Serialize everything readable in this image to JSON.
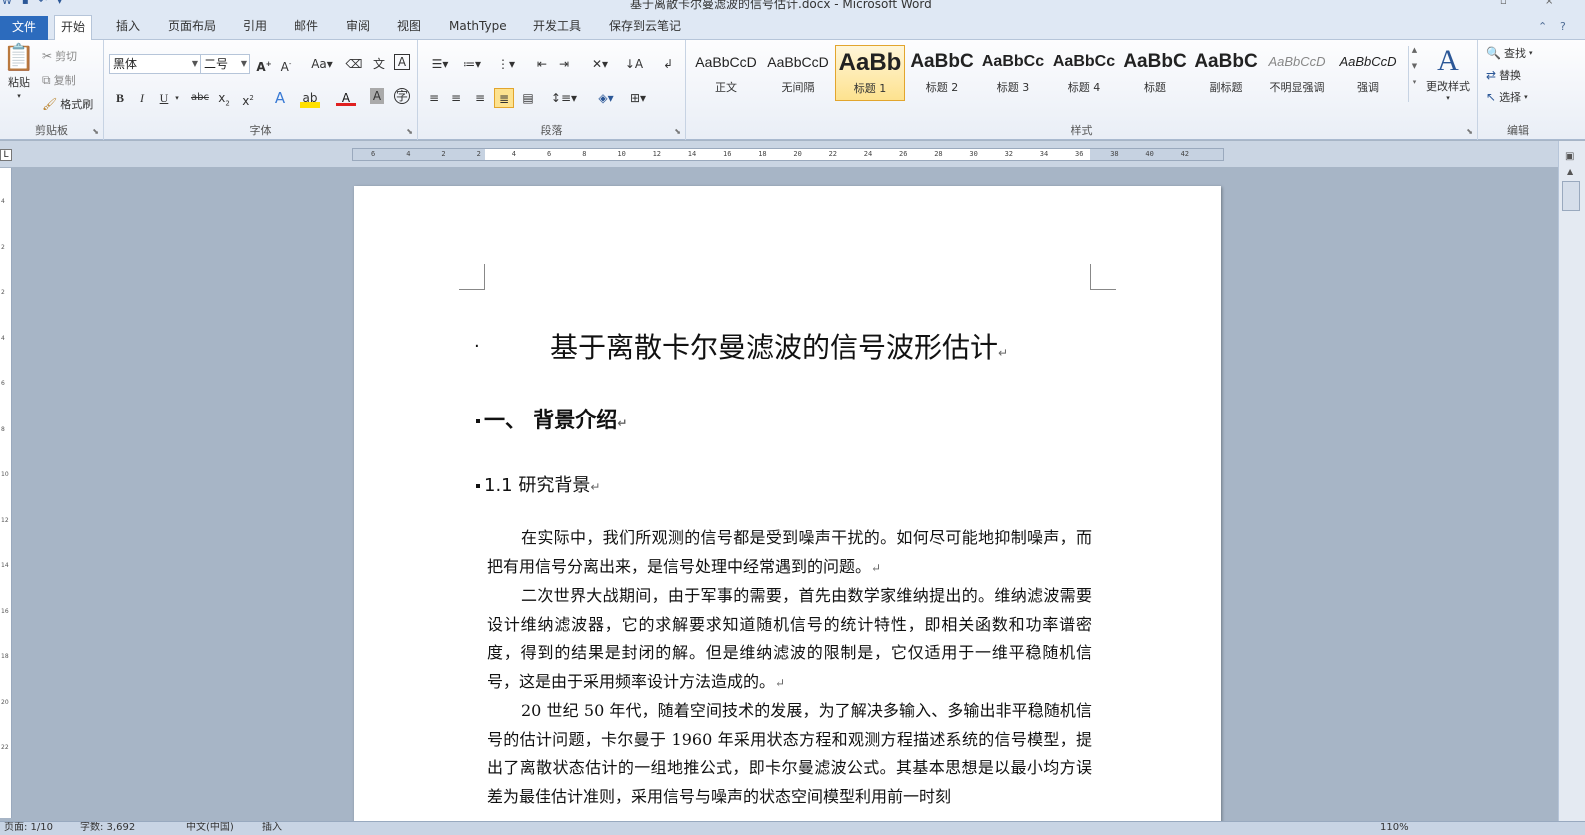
{
  "window": {
    "title": "基于离散卡尔曼滤波的信号估计.docx - Microsoft Word"
  },
  "tabs": [
    "文件",
    "开始",
    "插入",
    "页面布局",
    "引用",
    "邮件",
    "审阅",
    "视图",
    "MathType",
    "开发工具",
    "保存到云笔记"
  ],
  "active_tab": "开始",
  "clipboard": {
    "paste": "粘贴",
    "cut": "剪切",
    "copy": "复制",
    "format_painter": "格式刷",
    "label": "剪贴板"
  },
  "font": {
    "family": "黑体",
    "size": "二号",
    "label": "字体"
  },
  "paragraph": {
    "label": "段落"
  },
  "styles": {
    "label": "样式",
    "items": [
      {
        "preview": "AaBbCcD",
        "name": "正文"
      },
      {
        "preview": "AaBbCcD",
        "name": "无间隔"
      },
      {
        "preview": "AaBb",
        "name": "标题 1"
      },
      {
        "preview": "AaBbC",
        "name": "标题 2"
      },
      {
        "preview": "AaBbCc",
        "name": "标题 3"
      },
      {
        "preview": "AaBbCc",
        "name": "标题 4"
      },
      {
        "preview": "AaBbC",
        "name": "标题"
      },
      {
        "preview": "AaBbC",
        "name": "副标题"
      },
      {
        "preview": "AaBbCcD",
        "name": "不明显强调"
      },
      {
        "preview": "AaBbCcD",
        "name": "强调"
      }
    ],
    "change": "更改样式"
  },
  "editing": {
    "find": "查找",
    "replace": "替换",
    "select": "选择",
    "label": "编辑"
  },
  "ruler": {
    "ticks": [
      "6",
      "4",
      "2",
      "2",
      "4",
      "6",
      "8",
      "10",
      "12",
      "14",
      "16",
      "18",
      "20",
      "22",
      "24",
      "26",
      "28",
      "30",
      "32",
      "34",
      "36",
      "38",
      "40",
      "42"
    ],
    "vticks": [
      "4",
      "2",
      "2",
      "4",
      "6",
      "8",
      "10",
      "12",
      "14",
      "16",
      "18",
      "20",
      "22"
    ]
  },
  "document": {
    "title": "基于离散卡尔曼滤波的信号波形估计",
    "heading1": "一、  背景介绍",
    "heading2": "1.1  研究背景",
    "paragraphs": [
      "在实际中，我们所观测的信号都是受到噪声干扰的。如何尽可能地抑制噪声，而把有用信号分离出来，是信号处理中经常遇到的问题。",
      "二次世界大战期间，由于军事的需要，首先由数学家维纳提出的。维纳滤波需要设计维纳滤波器，它的求解要求知道随机信号的统计特性，即相关函数和功率谱密度，得到的结果是封闭的解。但是维纳滤波的限制是，它仅适用于一维平稳随机信号，这是由于采用频率设计方法造成的。",
      "20 世纪 50 年代，随着空间技术的发展，为了解决多输入、多输出非平稳随机信号的估计问题，卡尔曼于 1960 年采用状态方程和观测方程描述系统的信号模型，提出了离散状态估计的一组地推公式，即卡尔曼滤波公式。其基本思想是以最小均方误差为最佳估计准则，采用信号与噪声的状态空间模型利用前一时刻"
    ]
  },
  "status": {
    "page": "页面: 1/10",
    "words": "字数: 3,692",
    "lang": "中文(中国)",
    "mode": "插入",
    "zoom": "110%"
  }
}
